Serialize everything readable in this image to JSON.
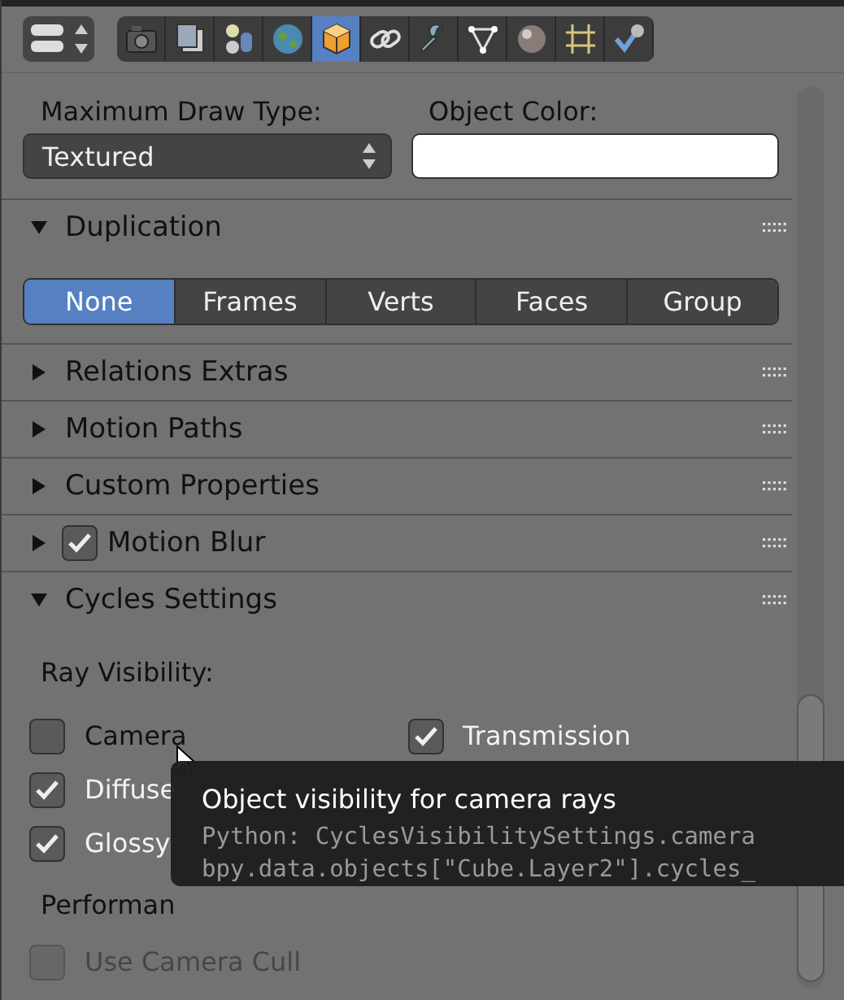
{
  "editor_type": {
    "kind": "selector"
  },
  "tabs": [
    {
      "selected": false
    },
    {
      "selected": false
    },
    {
      "selected": false
    },
    {
      "selected": false
    },
    {
      "selected": true
    },
    {
      "selected": false
    },
    {
      "selected": false
    },
    {
      "selected": false
    },
    {
      "selected": false
    },
    {
      "selected": false
    },
    {
      "selected": false
    }
  ],
  "draw_type": {
    "label": "Maximum Draw Type:",
    "value": "Textured"
  },
  "object_color": {
    "label": "Object Color:"
  },
  "duplication": {
    "title": "Duplication",
    "expanded": true,
    "options": [
      {
        "label": "None",
        "selected": true
      },
      {
        "label": "Frames",
        "selected": false
      },
      {
        "label": "Verts",
        "selected": false
      },
      {
        "label": "Faces",
        "selected": false
      },
      {
        "label": "Group",
        "selected": false
      }
    ]
  },
  "collapsed_panels": [
    {
      "title": "Relations Extras",
      "expanded": false
    },
    {
      "title": "Motion Paths",
      "expanded": false
    },
    {
      "title": "Custom Properties",
      "expanded": false
    },
    {
      "title": "Motion Blur",
      "expanded": false,
      "checked": true
    }
  ],
  "cycles": {
    "title": "Cycles Settings",
    "expanded": true,
    "ray_visibility_label": "Ray Visibility:",
    "rays_left": [
      {
        "label": "Camera",
        "checked": false
      },
      {
        "label": "Diffuse",
        "checked": true
      },
      {
        "label": "Glossy",
        "checked": true
      }
    ],
    "rays_right": [
      {
        "label": "Transmission",
        "checked": true
      }
    ],
    "performance_label": "Performan",
    "camera_cull": {
      "label": "Use Camera Cull",
      "checked": false,
      "disabled": true
    }
  },
  "tooltip": {
    "title": "Object visibility for camera rays",
    "lines": [
      "Python: CyclesVisibilitySettings.camera",
      "bpy.data.objects[\"Cube.Layer2\"].cycles_"
    ]
  }
}
